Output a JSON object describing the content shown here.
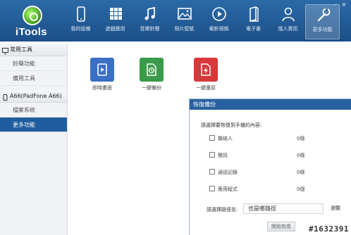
{
  "app": {
    "name": "iTools"
  },
  "nav": {
    "items": [
      {
        "label": "我的設備",
        "icon": "phone-icon"
      },
      {
        "label": "遊戲應用",
        "icon": "apps-grid-icon"
      },
      {
        "label": "音樂鈴聲",
        "icon": "music-note-icon"
      },
      {
        "label": "照片壁紙",
        "icon": "image-icon"
      },
      {
        "label": "電影視頻",
        "icon": "play-icon"
      },
      {
        "label": "電子書",
        "icon": "book-icon"
      },
      {
        "label": "個人資訊",
        "icon": "person-icon"
      },
      {
        "label": "更多功能",
        "icon": "wrench-icon",
        "active": true
      }
    ]
  },
  "window": {
    "minimize": "-",
    "close": "×"
  },
  "sidebar": {
    "common_header": "常用工具",
    "common_items": [
      "鈴聲功能",
      "備用工具"
    ],
    "device_header": "A66(PadFone A66)",
    "device_items": [
      "檔案系統",
      "更多功能"
    ]
  },
  "tools": [
    {
      "label": "即時畫面",
      "color": "#3b6fc4",
      "icon": "screen-play-icon"
    },
    {
      "label": "一鍵備份",
      "color": "#3a9b4a",
      "icon": "backup-clock-icon"
    },
    {
      "label": "一鍵還原",
      "color": "#d8383b",
      "icon": "restore-bolt-icon"
    }
  ],
  "dialog": {
    "title": "恢復備份",
    "prompt": "請選擇要恢復到手機的內容:",
    "options": [
      {
        "label": "聯絡人",
        "count": "0條"
      },
      {
        "label": "簡訊",
        "count": "0條"
      },
      {
        "label": "通話記錄",
        "count": "0條"
      },
      {
        "label": "應用程式",
        "count": "0個"
      }
    ],
    "path_label": "請選擇路徑名:",
    "path_value": "也是哪路徑",
    "browse_label": "瀏覽",
    "start_label": "開始恢復"
  },
  "watermark": "#1632391"
}
